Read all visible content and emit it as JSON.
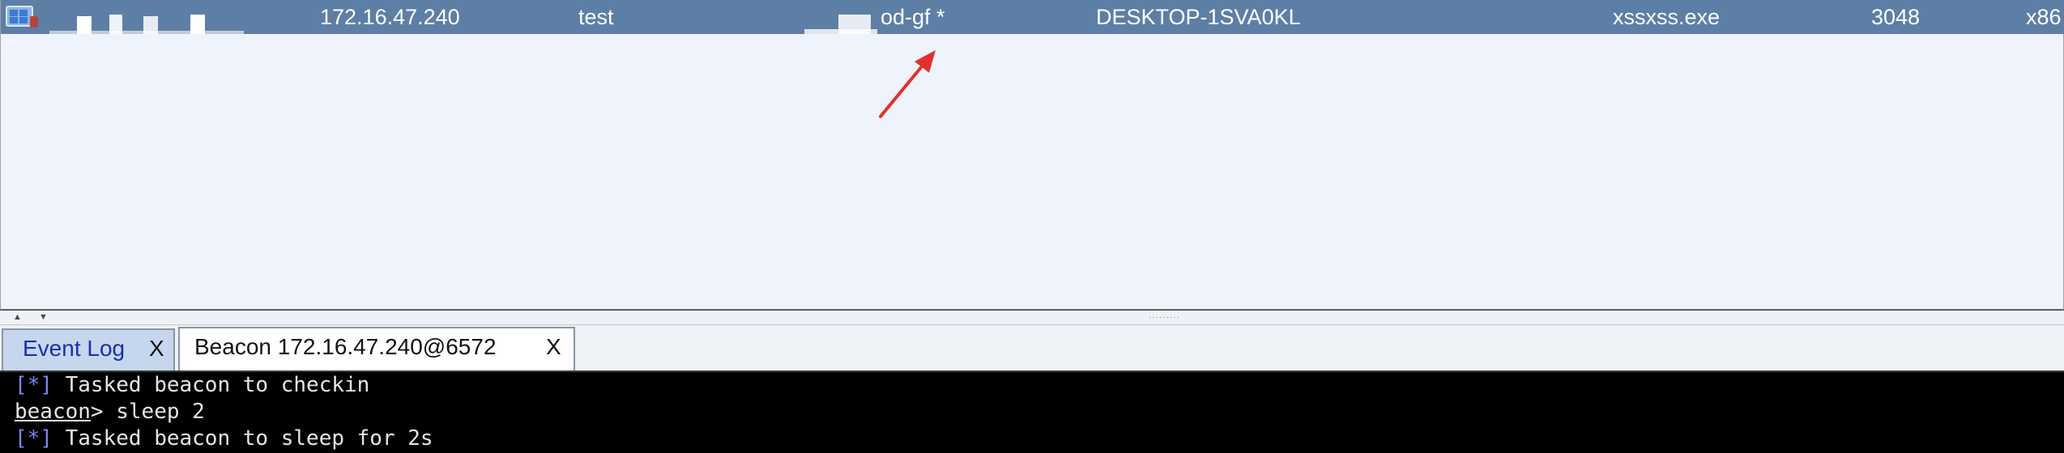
{
  "session": {
    "internal_ip": "172.16.47.240",
    "user": "test",
    "computer_partial": "od-gf *",
    "computer_name": "DESKTOP-1SVA0KL",
    "process": "xssxss.exe",
    "pid": "3048",
    "arch_partial": "x86",
    "row_color": "#5d7fa6"
  },
  "annotation": {
    "icon": "red-arrow-icon",
    "color": "#e0312c"
  },
  "tabs": [
    {
      "label": "Event Log",
      "close": "X",
      "active": false
    },
    {
      "label": "Beacon 172.16.47.240@6572",
      "close": "X",
      "active": true
    }
  ],
  "console": {
    "line1": {
      "marker": "[*]",
      "text": " Tasked beacon to checkin"
    },
    "line2": {
      "prompt": "beacon",
      "text": "> sleep 2"
    },
    "line3": {
      "marker": "[*]",
      "text": " Tasked beacon to sleep for 2s"
    }
  }
}
